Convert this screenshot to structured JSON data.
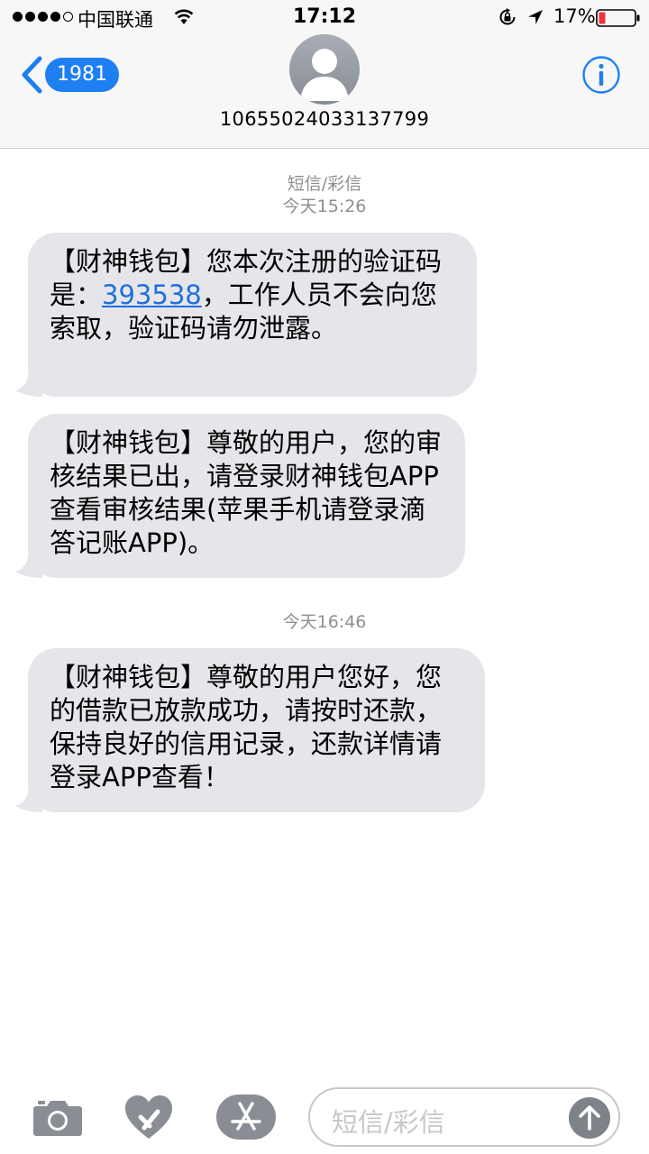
{
  "status_bar": {
    "carrier": "中国联通",
    "time": "17:12",
    "battery_percent": "17%"
  },
  "nav": {
    "back_badge": "1981",
    "contact_number": "10655024033137799"
  },
  "conversation": {
    "service_label": "短信/彩信",
    "timestamp_1": "今天15:26",
    "timestamp_2": "今天16:46",
    "messages": [
      {
        "text_before": "【财神钱包】您本次注册的验证码是：",
        "code": "393538",
        "text_after": "，工作人员不会向您索取，验证码请勿泄露。"
      },
      {
        "text": "【财神钱包】尊敬的用户，您的审核结果已出，请登录财神钱包APP查看审核结果(苹果手机请登录滴答记账APP)。"
      },
      {
        "text": "【财神钱包】尊敬的用户您好，您的借款已放款成功，请按时还款，保持良好的信用记录，还款详情请登录APP查看！"
      }
    ]
  },
  "input_bar": {
    "placeholder": "短信/彩信"
  },
  "colors": {
    "accent": "#1e7ff3",
    "bubble": "#e5e5ea",
    "link": "#1e6fdc",
    "battery_low": "#f0333a"
  }
}
